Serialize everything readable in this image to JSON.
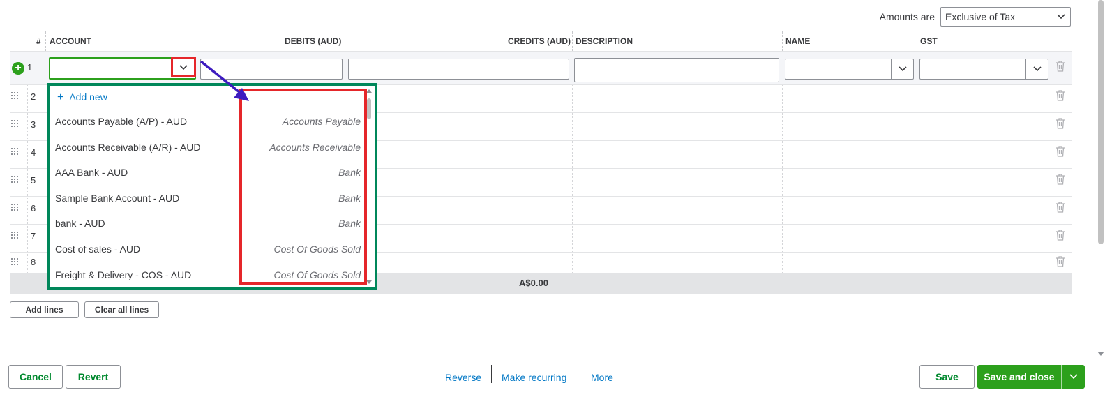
{
  "amounts": {
    "label": "Amounts are",
    "value": "Exclusive of Tax"
  },
  "table": {
    "headers": {
      "num": "#",
      "account": "ACCOUNT",
      "debits": "DEBITS (AUD)",
      "credits": "CREDITS (AUD)",
      "description": "DESCRIPTION",
      "name": "NAME",
      "gst": "GST"
    },
    "rows": [
      "1",
      "2",
      "3",
      "4",
      "5",
      "6",
      "7",
      "8"
    ],
    "credits_total": "A$0.00"
  },
  "dropdown": {
    "add_new": "Add new",
    "items": [
      {
        "name": "Accounts Payable (A/P)  - AUD",
        "type": "Accounts Payable"
      },
      {
        "name": "Accounts Receivable (A/R)  - AUD",
        "type": "Accounts Receivable"
      },
      {
        "name": "AAA Bank  - AUD",
        "type": "Bank"
      },
      {
        "name": "Sample Bank Account  - AUD",
        "type": "Bank"
      },
      {
        "name": "bank  - AUD",
        "type": "Bank"
      },
      {
        "name": "Cost of sales  - AUD",
        "type": "Cost Of Goods Sold"
      },
      {
        "name": "Freight & Delivery - COS  - AUD",
        "type": "Cost Of Goods Sold"
      }
    ]
  },
  "line_buttons": {
    "add_lines": "Add lines",
    "clear_all": "Clear all lines"
  },
  "footer": {
    "cancel": "Cancel",
    "revert": "Revert",
    "reverse": "Reverse",
    "make_recurring": "Make recurring",
    "more": "More",
    "save": "Save",
    "save_and_close": "Save and close"
  },
  "colors": {
    "green": "#2ca01c",
    "link_blue": "#0077c5",
    "highlight_red": "#e5262a",
    "dropdown_border": "#00875a",
    "arrow": "#3d1bbf"
  }
}
